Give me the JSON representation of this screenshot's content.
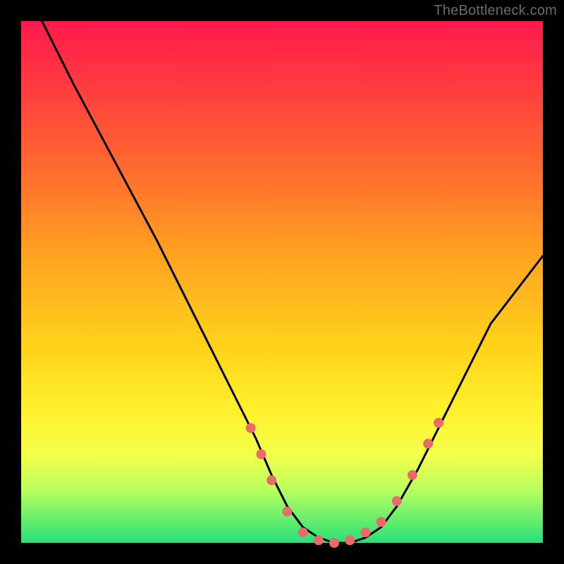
{
  "watermark": "TheBottleneck.com",
  "chart_data": {
    "type": "line",
    "title": "",
    "xlabel": "",
    "ylabel": "",
    "xlim": [
      0,
      100
    ],
    "ylim": [
      0,
      100
    ],
    "grid": false,
    "series": [
      {
        "name": "curve",
        "color": "#000000",
        "x": [
          4,
          10,
          18,
          26,
          34,
          40,
          45,
          48,
          51,
          54,
          57,
          60,
          63,
          66,
          69,
          72,
          76,
          82,
          90,
          100
        ],
        "y": [
          100,
          88,
          73,
          58,
          42,
          30,
          20,
          13,
          7,
          3,
          1,
          0,
          0,
          1,
          3,
          7,
          14,
          26,
          42,
          55
        ]
      }
    ],
    "markers": {
      "color": "#e86a6a",
      "radius_px": 7,
      "points": [
        {
          "x": 44,
          "y": 22
        },
        {
          "x": 46,
          "y": 17
        },
        {
          "x": 48,
          "y": 12
        },
        {
          "x": 51,
          "y": 6
        },
        {
          "x": 54,
          "y": 2
        },
        {
          "x": 57,
          "y": 0.5
        },
        {
          "x": 60,
          "y": 0
        },
        {
          "x": 63,
          "y": 0.5
        },
        {
          "x": 66,
          "y": 2
        },
        {
          "x": 69,
          "y": 4
        },
        {
          "x": 72,
          "y": 8
        },
        {
          "x": 75,
          "y": 13
        },
        {
          "x": 78,
          "y": 19
        },
        {
          "x": 80,
          "y": 23
        }
      ]
    }
  }
}
